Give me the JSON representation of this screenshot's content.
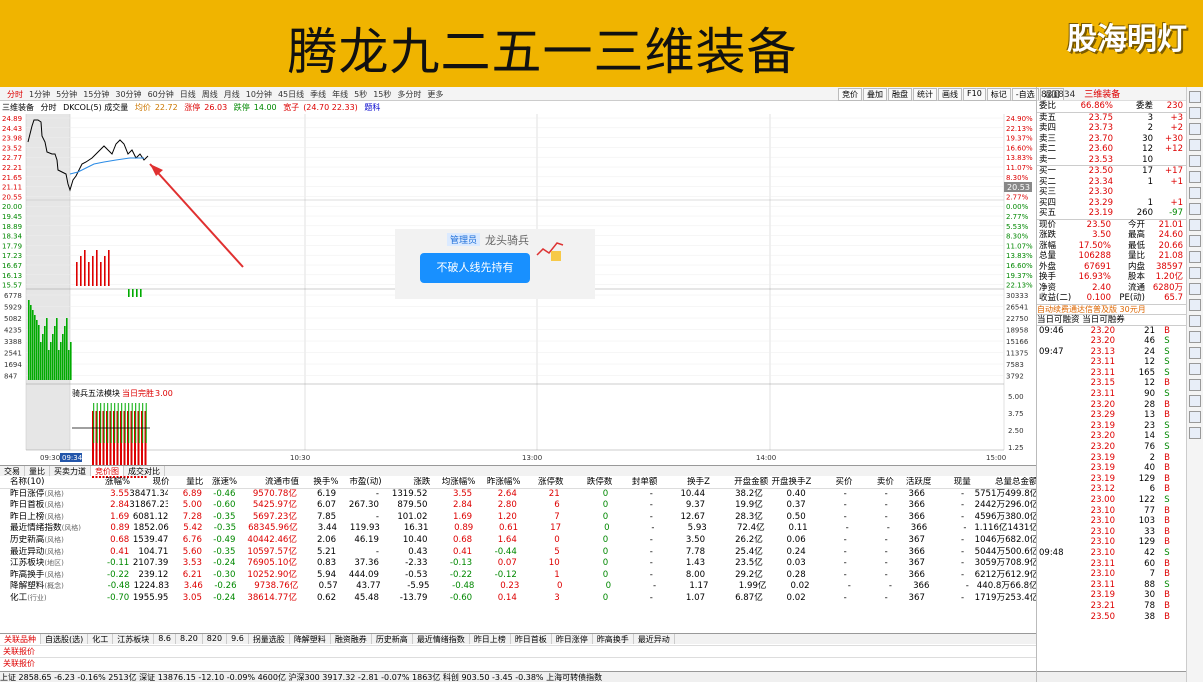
{
  "banner": {
    "title": "腾龙九二五一三维装备",
    "logo": "股海明灯"
  },
  "toolbar": {
    "periods": [
      "分时",
      "1分钟",
      "5分钟",
      "15分钟",
      "30分钟",
      "60分钟",
      "日线",
      "周线",
      "月线",
      "10分钟",
      "45日线",
      "季线",
      "年线",
      "5秒",
      "15秒",
      "多分时",
      "更多"
    ],
    "tools": [
      "竞价",
      "叠加",
      "融盘",
      "统计",
      "画线",
      "F10",
      "标记",
      "-自选",
      "返回"
    ]
  },
  "chartinfo": {
    "name": "三维装备",
    "mode": "分时",
    "indicator": "DKCOL(5) 成交量",
    "avg_label": "均价",
    "avg": "22.72",
    "kind_label": "涨停",
    "kind": "26.03",
    "drop_label": "跌停",
    "drop": "14.00",
    "range_label": "宽子",
    "range": "(24.70 22.33)",
    "extra": "题科"
  },
  "chart_axes": {
    "price_left": [
      "24.89",
      "24.43",
      "23.98",
      "23.52",
      "22.77",
      "22.21",
      "21.65",
      "21.11",
      "20.55",
      "20.00",
      "19.45",
      "18.89",
      "18.34",
      "17.79",
      "17.23",
      "16.67",
      "16.13",
      "15.57"
    ],
    "pct_right": [
      "24.90%",
      "22.13%",
      "19.37%",
      "16.60%",
      "13.83%",
      "11.07%",
      "8.30%",
      "5.53%",
      "2.77%",
      "0.00%",
      "2.77%",
      "5.53%",
      "8.30%",
      "11.07%",
      "13.83%",
      "16.60%",
      "19.37%",
      "22.13%"
    ],
    "vol_left": [
      "6778",
      "5929",
      "5082",
      "4235",
      "3388",
      "2541",
      "1694",
      "847"
    ],
    "vol_right": [
      "30333",
      "26541",
      "22750",
      "18958",
      "15166",
      "11375",
      "7583",
      "3792"
    ],
    "lower_right": [
      "5.00",
      "3.75",
      "2.50",
      "1.25"
    ],
    "lower_label": "骑兵五法模块",
    "lower_sub": "当日完胜",
    "lower_val": "3.00",
    "price_tag": "20.53",
    "time_axis": [
      "09:30",
      "10:30",
      "13:00",
      "14:00",
      "15:00"
    ],
    "time_cursor": "09:34"
  },
  "popup": {
    "badge": "管理员",
    "user": "龙头骑兵",
    "button": "不破人线先持有"
  },
  "quote": {
    "code": "831834",
    "name": "三维装备",
    "weibi_label": "委比",
    "weibi": "66.86%",
    "weicha_label": "委差",
    "weicha": "230",
    "asks": [
      {
        "label": "卖五",
        "price": "23.75",
        "vol": "3",
        "chg": "+3"
      },
      {
        "label": "卖四",
        "price": "23.73",
        "vol": "2",
        "chg": "+2"
      },
      {
        "label": "卖三",
        "price": "23.70",
        "vol": "30",
        "chg": "+30"
      },
      {
        "label": "卖二",
        "price": "23.60",
        "vol": "12",
        "chg": "+12"
      },
      {
        "label": "卖一",
        "price": "23.53",
        "vol": "10",
        "chg": ""
      }
    ],
    "bids": [
      {
        "label": "买一",
        "price": "23.50",
        "vol": "17",
        "chg": "+17"
      },
      {
        "label": "买二",
        "price": "23.34",
        "vol": "1",
        "chg": "+1"
      },
      {
        "label": "买三",
        "price": "23.30",
        "vol": "",
        "chg": ""
      },
      {
        "label": "买四",
        "price": "23.29",
        "vol": "1",
        "chg": "+1"
      },
      {
        "label": "买五",
        "price": "23.19",
        "vol": "260",
        "chg": "-97"
      }
    ],
    "stats": [
      [
        "现价",
        "23.50",
        "今开",
        "21.01"
      ],
      [
        "涨跌",
        "3.50",
        "最高",
        "24.60"
      ],
      [
        "涨幅",
        "17.50%",
        "最低",
        "20.66"
      ],
      [
        "总量",
        "106288",
        "量比",
        "21.08"
      ],
      [
        "外盘",
        "67691",
        "内盘",
        "38597"
      ],
      [
        "换手",
        "16.93%",
        "股本",
        "1.20亿"
      ],
      [
        "净资",
        "2.40",
        "流通",
        "6280万"
      ],
      [
        "收益(二)",
        "0.100",
        "PE(动)",
        "65.7"
      ]
    ],
    "notice": "自动续费通达信普及版 30元月",
    "margin": "当日可融资 当日可融券"
  },
  "ticks": [
    [
      "09:46",
      "23.20",
      "21",
      "B"
    ],
    [
      "",
      "23.20",
      "46",
      "S"
    ],
    [
      "09:47",
      "23.13",
      "24",
      "S"
    ],
    [
      "",
      "23.11",
      "12",
      "S"
    ],
    [
      "",
      "23.11",
      "165",
      "S"
    ],
    [
      "",
      "23.15",
      "12",
      "B"
    ],
    [
      "",
      "23.11",
      "90",
      "S"
    ],
    [
      "",
      "23.20",
      "28",
      "B"
    ],
    [
      "",
      "23.29",
      "13",
      "B"
    ],
    [
      "",
      "23.19",
      "23",
      "S"
    ],
    [
      "",
      "23.20",
      "14",
      "S"
    ],
    [
      "",
      "23.20",
      "76",
      "S"
    ],
    [
      "",
      "23.19",
      "2",
      "B"
    ],
    [
      "",
      "23.19",
      "40",
      "B"
    ],
    [
      "",
      "23.19",
      "129",
      "B"
    ],
    [
      "",
      "23.12",
      "6",
      "B"
    ],
    [
      "",
      "23.00",
      "122",
      "S"
    ],
    [
      "",
      "23.10",
      "77",
      "B"
    ],
    [
      "",
      "23.10",
      "103",
      "B"
    ],
    [
      "",
      "23.10",
      "33",
      "B"
    ],
    [
      "",
      "23.10",
      "129",
      "B"
    ],
    [
      "09:48",
      "23.10",
      "42",
      "S"
    ],
    [
      "",
      "23.11",
      "60",
      "B"
    ],
    [
      "",
      "23.10",
      "7",
      "B"
    ],
    [
      "",
      "23.11",
      "88",
      "S"
    ],
    [
      "",
      "23.19",
      "30",
      "B"
    ],
    [
      "",
      "23.21",
      "78",
      "B"
    ],
    [
      "",
      "23.50",
      "38",
      "B"
    ]
  ],
  "midtabs": [
    "交易",
    "量比",
    "买卖力道",
    "竞价图",
    "成交对比"
  ],
  "table": {
    "headers": [
      "名称(10)",
      "涨幅%",
      "现价",
      "量比",
      "涨速%",
      "流通市值",
      "换手%",
      "市盈(动)",
      "涨跌",
      "均涨幅%",
      "昨涨幅%",
      "涨停数",
      "跌停数",
      "封单额",
      "换手Z",
      "开盘金额",
      "开盘换手Z",
      "买价",
      "卖价",
      "活跃度",
      "现量",
      "总量",
      "总金额"
    ],
    "rows": [
      [
        "昨日涨停",
        "(风格)",
        "3.55",
        "38471.34",
        "6.89",
        "-0.46",
        "9570.78亿",
        "6.19",
        "-",
        "1319.52",
        "3.55",
        "2.64",
        "21",
        "0",
        "-",
        "10.44",
        "38.2亿",
        "0.40",
        "-",
        "-",
        "366",
        "-",
        "5751万",
        "499.8亿"
      ],
      [
        "昨日首板",
        "(风格)",
        "2.84",
        "31867.23",
        "5.00",
        "-0.60",
        "5425.97亿",
        "6.07",
        "267.30",
        "879.50",
        "2.84",
        "2.80",
        "6",
        "0",
        "-",
        "9.37",
        "19.9亿",
        "0.37",
        "-",
        "-",
        "366",
        "-",
        "2442万",
        "296.0亿"
      ],
      [
        "昨日上榜",
        "(风格)",
        "1.69",
        "6081.12",
        "7.28",
        "-0.35",
        "5697.23亿",
        "7.85",
        "-",
        "101.02",
        "1.69",
        "1.20",
        "7",
        "0",
        "-",
        "12.67",
        "28.3亿",
        "0.50",
        "-",
        "-",
        "366",
        "-",
        "4596万",
        "380.0亿"
      ],
      [
        "最近情绪指数",
        "(风格)",
        "0.89",
        "1852.06",
        "5.42",
        "-0.35",
        "68345.96亿",
        "3.44",
        "119.93",
        "16.31",
        "0.89",
        "0.61",
        "17",
        "0",
        "-",
        "5.93",
        "72.4亿",
        "0.11",
        "-",
        "-",
        "366",
        "-",
        "1.116亿",
        "1431亿"
      ],
      [
        "历史新高",
        "(风格)",
        "0.68",
        "1539.47",
        "6.76",
        "-0.49",
        "40442.46亿",
        "2.06",
        "46.19",
        "10.40",
        "0.68",
        "1.64",
        "0",
        "0",
        "-",
        "3.50",
        "26.2亿",
        "0.06",
        "-",
        "-",
        "367",
        "-",
        "1046万",
        "682.0亿"
      ],
      [
        "最近异动",
        "(风格)",
        "0.41",
        "104.71",
        "5.60",
        "-0.35",
        "10597.57亿",
        "5.21",
        "-",
        "0.43",
        "0.41",
        "-0.44",
        "5",
        "0",
        "-",
        "7.78",
        "25.4亿",
        "0.24",
        "-",
        "-",
        "366",
        "-",
        "5044万",
        "500.6亿"
      ],
      [
        "江苏板块",
        "(地区)",
        "-0.11",
        "2107.39",
        "3.53",
        "-0.24",
        "76905.10亿",
        "0.83",
        "37.36",
        "-2.33",
        "-0.13",
        "0.07",
        "10",
        "0",
        "-",
        "1.43",
        "23.5亿",
        "0.03",
        "-",
        "-",
        "367",
        "-",
        "3059万",
        "708.9亿"
      ],
      [
        "昨高换手",
        "(风格)",
        "-0.22",
        "239.12",
        "6.21",
        "-0.30",
        "10252.90亿",
        "5.94",
        "444.09",
        "-0.53",
        "-0.22",
        "-0.12",
        "1",
        "0",
        "-",
        "8.00",
        "29.2亿",
        "0.28",
        "-",
        "-",
        "366",
        "-",
        "6212万",
        "612.9亿"
      ],
      [
        "降解塑料",
        "(概念)",
        "-0.48",
        "1224.83",
        "3.46",
        "-0.26",
        "9738.76亿",
        "0.57",
        "43.77",
        "-5.95",
        "-0.48",
        "0.23",
        "0",
        "0",
        "-",
        "1.17",
        "1.99亿",
        "0.02",
        "-",
        "-",
        "366",
        "-",
        "440.8万",
        "66.8亿"
      ],
      [
        "化工",
        "(行业)",
        "-0.70",
        "1955.95",
        "3.05",
        "-0.24",
        "38614.77亿",
        "0.62",
        "45.48",
        "-13.79",
        "-0.60",
        "0.14",
        "3",
        "0",
        "-",
        "1.07",
        "6.87亿",
        "0.02",
        "-",
        "-",
        "367",
        "-",
        "1719万",
        "253.4亿"
      ]
    ]
  },
  "bottomtabs": [
    "关联品种",
    "自选股(选)",
    "化工",
    "江苏板块",
    "8.6",
    "8.20",
    "820",
    "9.6",
    "拐量选股",
    "降解塑料",
    "融资融券",
    "历史新高",
    "最近情绪指数",
    "昨日上榜",
    "昨日首板",
    "昨日涨停",
    "昨高换手",
    "最近异动"
  ],
  "blines": [
    "关联报价",
    "关联报价"
  ],
  "blines_right": "普及数据说明",
  "statusbar": "上证 2858.65  -6.23  -0.16%  2513亿   深证 13876.15  -12.10  -0.09%  4600亿   沪深300 3917.32  -2.81  -0.07%  1863亿   科创 903.50  -3.45  -0.38%   上海可转债指数"
}
